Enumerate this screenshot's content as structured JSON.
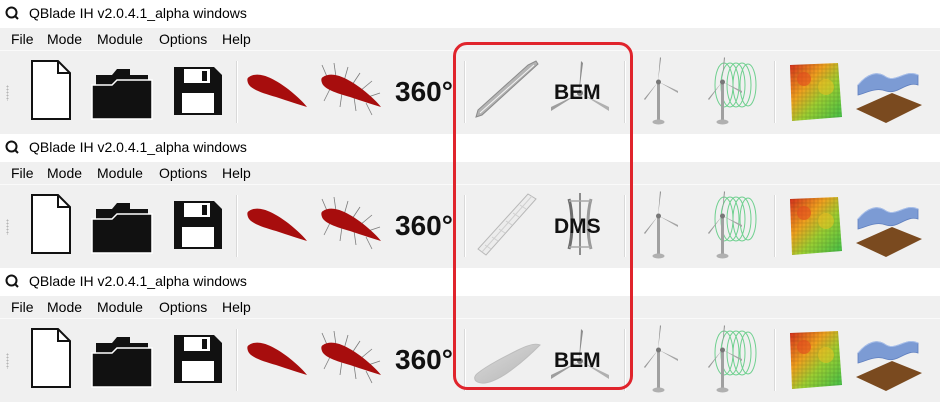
{
  "windows": [
    {
      "title": "QBlade IH v2.0.4.1_alpha windows",
      "menu": [
        "File",
        "Mode",
        "Module",
        "Options",
        "Help"
      ],
      "degree_label": "360°",
      "module_label": "BEM",
      "blade_variant": "thin"
    },
    {
      "title": "QBlade IH v2.0.4.1_alpha windows",
      "menu": [
        "File",
        "Mode",
        "Module",
        "Options",
        "Help"
      ],
      "degree_label": "360°",
      "module_label": "DMS",
      "blade_variant": "straight"
    },
    {
      "title": "QBlade IH v2.0.4.1_alpha windows",
      "menu": [
        "File",
        "Mode",
        "Module",
        "Options",
        "Help"
      ],
      "degree_label": "360°",
      "module_label": "BEM",
      "blade_variant": "fat"
    }
  ],
  "icons": {
    "toolbar": [
      "new-file-icon",
      "open-folder-icon",
      "save-icon",
      "airfoil-icon",
      "polar-mesh-icon",
      "polar-360-icon",
      "blade-design-icon",
      "module-simulation-icon",
      "turbine-icon",
      "turbine-wake-icon",
      "wind-field-icon",
      "terrain-surface-icon"
    ]
  },
  "colors": {
    "highlight": "#e0242c",
    "airfoil": "#a70d0d",
    "toolbar_bg": "#f0f0f0",
    "terrain_brown": "#7a4a1f",
    "surface_blue": "#7c9bd4"
  }
}
